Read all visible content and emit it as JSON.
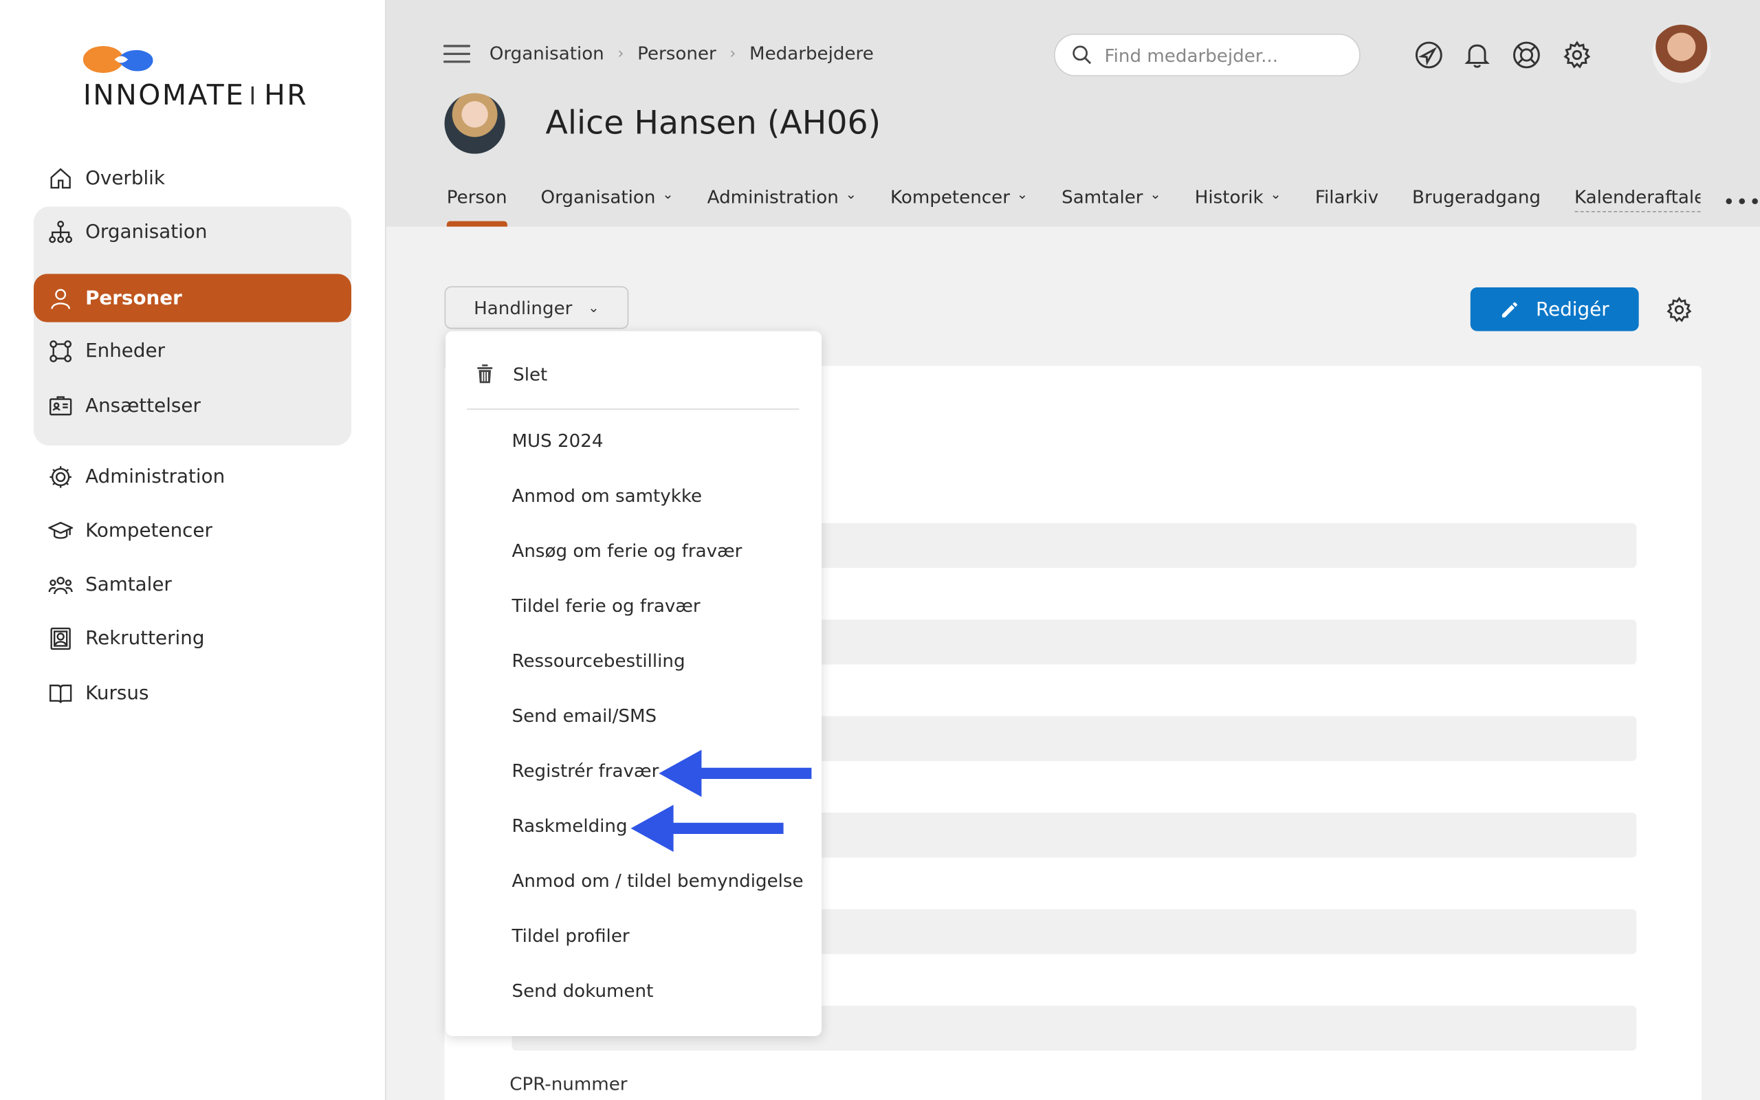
{
  "brand": {
    "name_left": "INNOMATE",
    "name_right": "HR"
  },
  "sidebar": {
    "items": [
      {
        "label": "Overblik",
        "icon": "home-icon"
      },
      {
        "label": "Organisation",
        "icon": "org-chart-icon"
      },
      {
        "label": "Personer",
        "icon": "user-icon"
      },
      {
        "label": "Enheder",
        "icon": "network-icon"
      },
      {
        "label": "Ansættelser",
        "icon": "id-card-icon"
      },
      {
        "label": "Administration",
        "icon": "gear-people-icon"
      },
      {
        "label": "Kompetencer",
        "icon": "graduation-cap-icon"
      },
      {
        "label": "Samtaler",
        "icon": "group-icon"
      },
      {
        "label": "Rekruttering",
        "icon": "badge-icon"
      },
      {
        "label": "Kursus",
        "icon": "book-icon"
      }
    ]
  },
  "header": {
    "breadcrumb": [
      "Organisation",
      "Personer",
      "Medarbejdere"
    ],
    "search_placeholder": "Find medarbejder...",
    "person_name": "Alice Hansen (AH06)",
    "tabs": [
      "Person",
      "Organisation",
      "Administration",
      "Kompetencer",
      "Samtaler",
      "Historik",
      "Filarkiv",
      "Brugeradgang",
      "Kalenderaftaler"
    ]
  },
  "toolbar": {
    "actions_label": "Handlinger",
    "edit_label": "Redigér"
  },
  "menu": {
    "delete_label": "Slet",
    "items": [
      "MUS 2024",
      "Anmod om samtykke",
      "Ansøg om ferie og fravær",
      "Tildel ferie og fravær",
      "Ressourcebestilling",
      "Send email/SMS",
      "Registrér fravær",
      "Raskmelding",
      "Anmod om / tildel bemyndigelse",
      "Tildel profiler",
      "Send dokument"
    ]
  },
  "panel": {
    "cpr_label": "CPR-nummer"
  },
  "colors": {
    "accent": "#c0561e",
    "primary_button": "#0b77c8",
    "arrow": "#2f55e6"
  }
}
